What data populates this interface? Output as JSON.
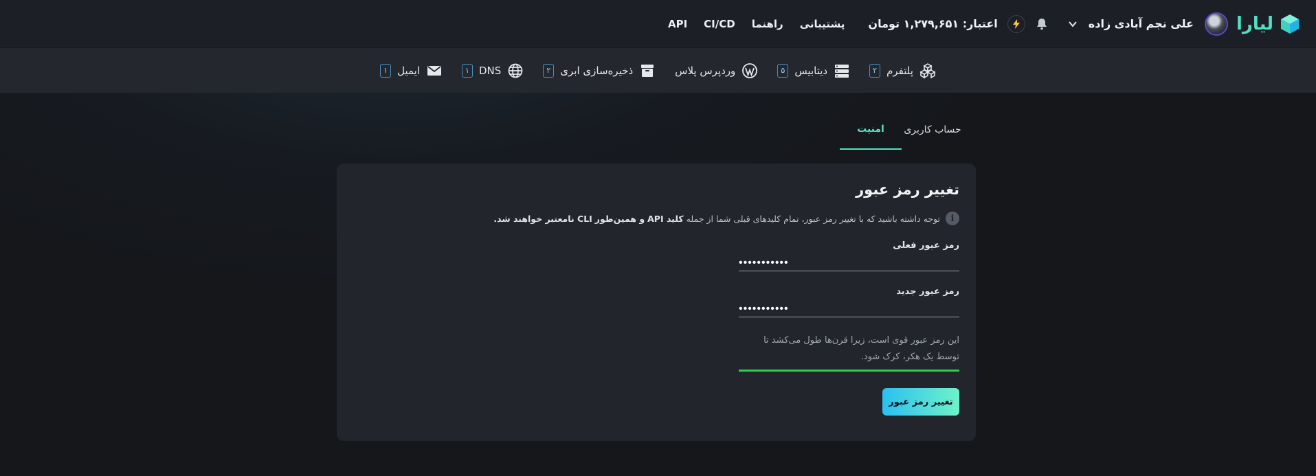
{
  "header": {
    "logo_text": "لیارا",
    "user_name": "علی نجم آبادی زاده",
    "credit": "اعتبار: ۱,۲۷۹,۶۵۱ تومان",
    "nav": [
      "پشتیبانی",
      "راهنما",
      "CI/CD",
      "API"
    ],
    "colors": {
      "brand": "#4fe0c6",
      "avatar_ring": "#5a48c9"
    },
    "icons": [
      "cube-logo-icon",
      "chevron-down-icon",
      "bell-icon",
      "bolt-icon"
    ]
  },
  "services": [
    {
      "label": "پلتفرم",
      "count": "۲",
      "icon": "platform-icon"
    },
    {
      "label": "دیتابیس",
      "count": "۵",
      "icon": "database-icon"
    },
    {
      "label": "وردپرس پلاس",
      "count": "",
      "icon": "wordpress-icon"
    },
    {
      "label": "ذخیره‌سازی ابری",
      "count": "۲",
      "icon": "archive-icon"
    },
    {
      "label": "DNS",
      "count": "۱",
      "icon": "globe-icon"
    },
    {
      "label": "ایمیل",
      "count": "۱",
      "icon": "mail-icon"
    }
  ],
  "tabs": [
    {
      "label": "حساب کاربری",
      "active": false
    },
    {
      "label": "امنیت",
      "active": true
    }
  ],
  "card": {
    "title": "تغییر رمز عبور",
    "notice_pre": "توجه داشته باشید که با تغییر رمز عبور، تمام کلیدهای قبلی شما از جمله",
    "notice_bold_1": "کلید API",
    "notice_mid": "و همین‌طور",
    "notice_bold_2": "CLI نامعتبر خواهند شد.",
    "current_password_label": "رمز عبور فعلی",
    "current_password_value": "•••••••••••",
    "new_password_label": "رمز عبور جدید",
    "new_password_value": "•••••••••••",
    "strength_text": "این رمز عبور قوی است، زیرا قرن‌ها طول می‌کشد تا توسط یک هکر، کرک شود.",
    "submit_label": "تغییر رمز عبور",
    "colors": {
      "accent": "#53e3c0",
      "strength": "#2fcf4e"
    }
  }
}
